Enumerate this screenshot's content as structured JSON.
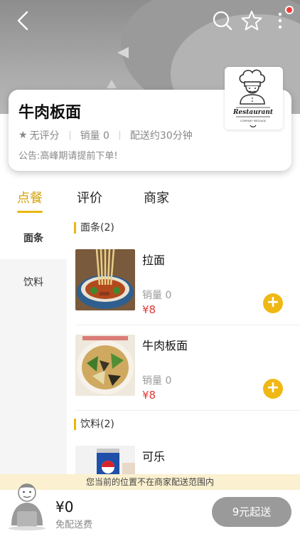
{
  "header": {
    "back_icon": "chevron-left-icon",
    "search_icon": "search-icon",
    "favorite_icon": "star-outline-icon",
    "more_icon": "more-vertical-icon"
  },
  "shop": {
    "name": "牛肉板面",
    "rating": "无评分",
    "sales": "销量 0",
    "delivery_time": "配送约30分钟",
    "notice": "公告:高峰期请提前下单!",
    "logo_text": "Restaurant",
    "logo_subtext": "COMPANY MESSAGE"
  },
  "tabs": [
    {
      "label": "点餐",
      "active": true
    },
    {
      "label": "评价",
      "active": false
    },
    {
      "label": "商家",
      "active": false
    }
  ],
  "sidebar": {
    "items": [
      {
        "label": "面条",
        "active": true
      },
      {
        "label": "饮料",
        "active": false
      }
    ]
  },
  "menu": {
    "categories": [
      {
        "title": "面条(2)",
        "items": [
          {
            "name": "拉面",
            "sales": "销量 0",
            "price": "¥8"
          },
          {
            "name": "牛肉板面",
            "sales": "销量 0",
            "price": "¥8"
          }
        ]
      },
      {
        "title": "饮料(2)",
        "items": [
          {
            "name": "可乐"
          }
        ]
      }
    ]
  },
  "notice_bar": "您当前的位置不在商家配送范围内",
  "cart": {
    "total": "¥0",
    "delivery_fee": "免配送费",
    "checkout_label": "9元起送"
  },
  "colors": {
    "accent": "#e9b80f",
    "price": "#e53935",
    "checkout_disabled": "#9a9a9a",
    "notice_bg": "#fbf0cf"
  }
}
